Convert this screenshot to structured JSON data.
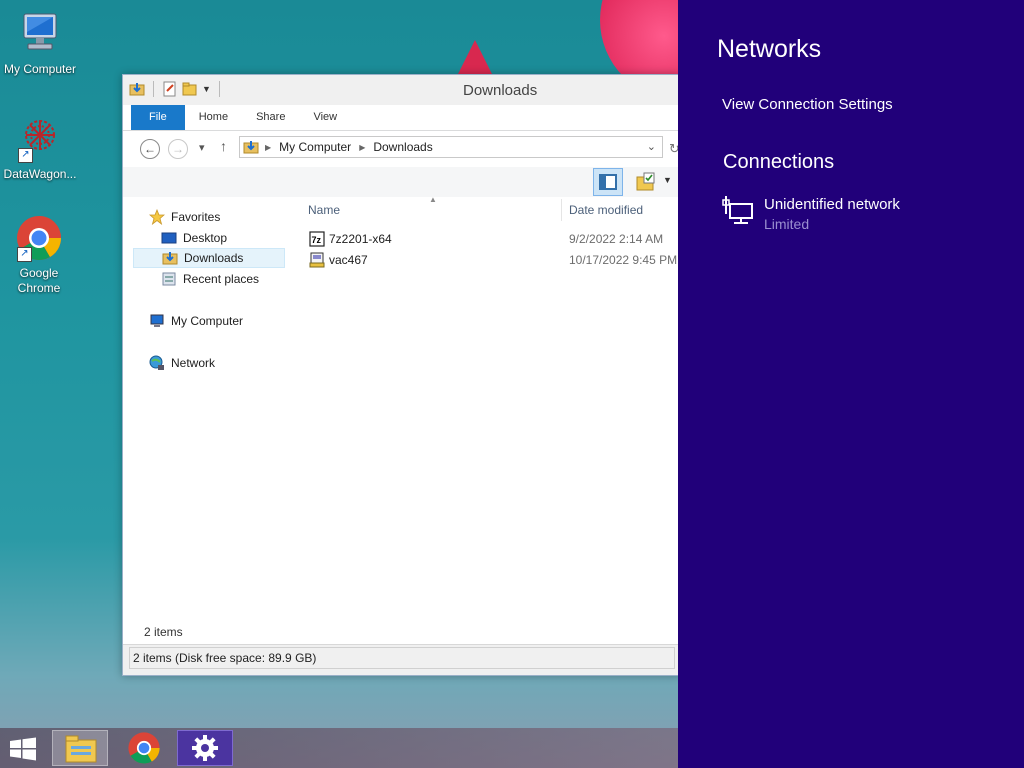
{
  "desktop": {
    "icons": [
      {
        "label": "My Computer"
      },
      {
        "label": "DataWagon..."
      },
      {
        "label": "Google Chrome"
      }
    ]
  },
  "explorer": {
    "title": "Downloads",
    "ribbon_tabs": [
      "File",
      "Home",
      "Share",
      "View"
    ],
    "address": {
      "crumbs": [
        "My Computer",
        "Downloads"
      ]
    },
    "nav": {
      "favorites": "Favorites",
      "desktop": "Desktop",
      "downloads": "Downloads",
      "recent": "Recent places",
      "computer": "My Computer",
      "network": "Network"
    },
    "columns": {
      "name": "Name",
      "date": "Date modified"
    },
    "files": [
      {
        "name": "7z2201-x64",
        "date": "9/2/2022 2:14 AM",
        "icon": "7zip-installer-icon"
      },
      {
        "name": "vac467",
        "date": "10/17/2022 9:45 PM",
        "icon": "installer-icon"
      }
    ],
    "item_count": "2 items",
    "status": "2 items (Disk free space: 89.9 GB)"
  },
  "charm": {
    "title": "Networks",
    "view_settings": "View Connection Settings",
    "section": "Connections",
    "network_name": "Unidentified network",
    "network_status": "Limited"
  },
  "colors": {
    "charm_bg": "#21007a",
    "file_tab": "#1979ca",
    "selected_nav": "#e5f3fb"
  }
}
